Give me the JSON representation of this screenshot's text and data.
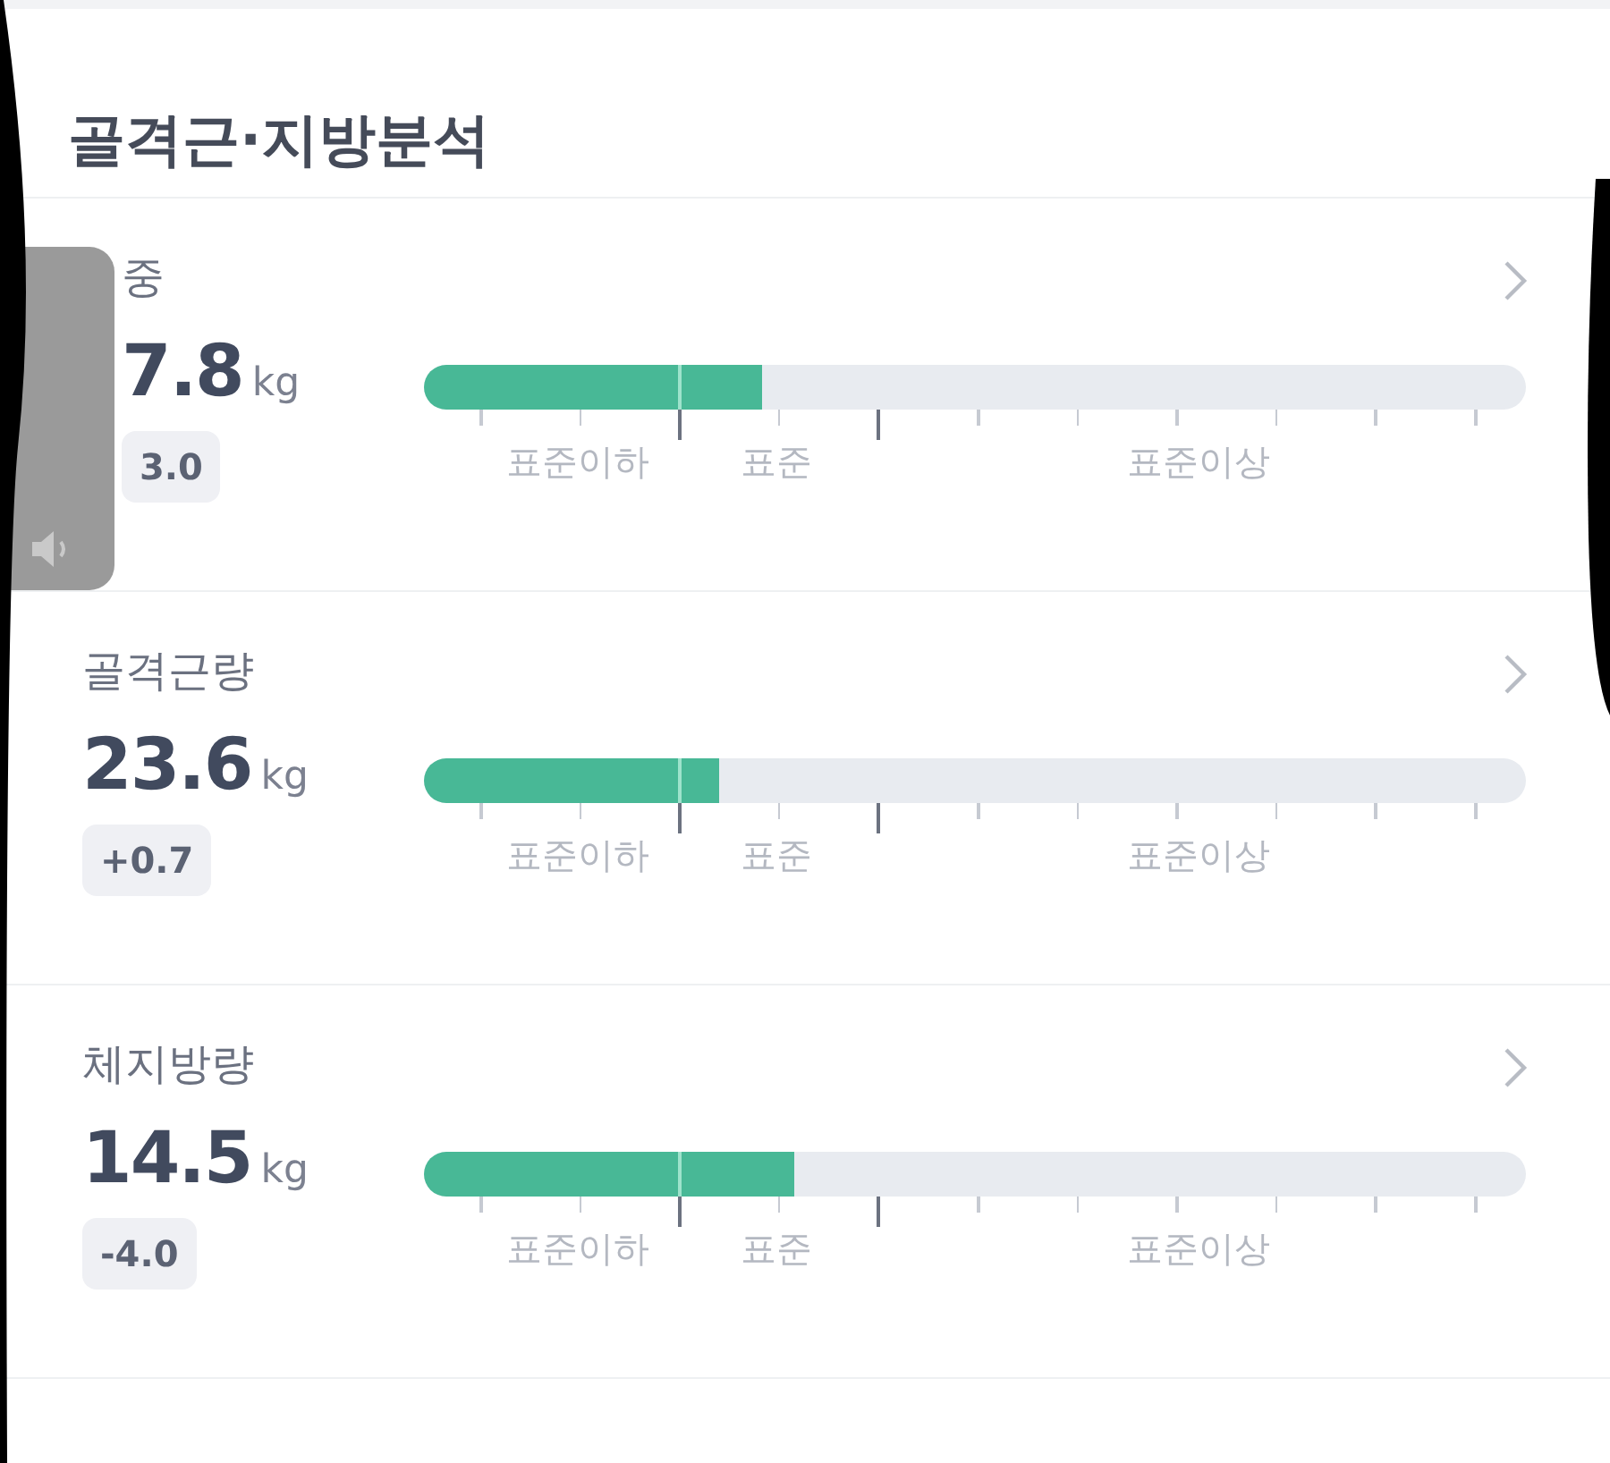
{
  "title": "골격근·지방분석",
  "volume_overlay": {
    "shown": true
  },
  "metrics": [
    {
      "name": "중",
      "value": "7.8",
      "unit": "kg",
      "change": "3.0",
      "level": 0.307,
      "scale_labels": [
        "표준이하",
        "표준",
        "표준이상"
      ]
    },
    {
      "name": "골격근량",
      "value": "23.6",
      "unit": "kg",
      "change": "+0.7",
      "level": 0.268,
      "scale_labels": [
        "표준이하",
        "표준",
        "표준이상"
      ]
    },
    {
      "name": "체지방량",
      "value": "14.5",
      "unit": "kg",
      "change": "-4.0",
      "level": 0.336,
      "scale_labels": [
        "표준이하",
        "표준",
        "표준이상"
      ]
    }
  ]
}
